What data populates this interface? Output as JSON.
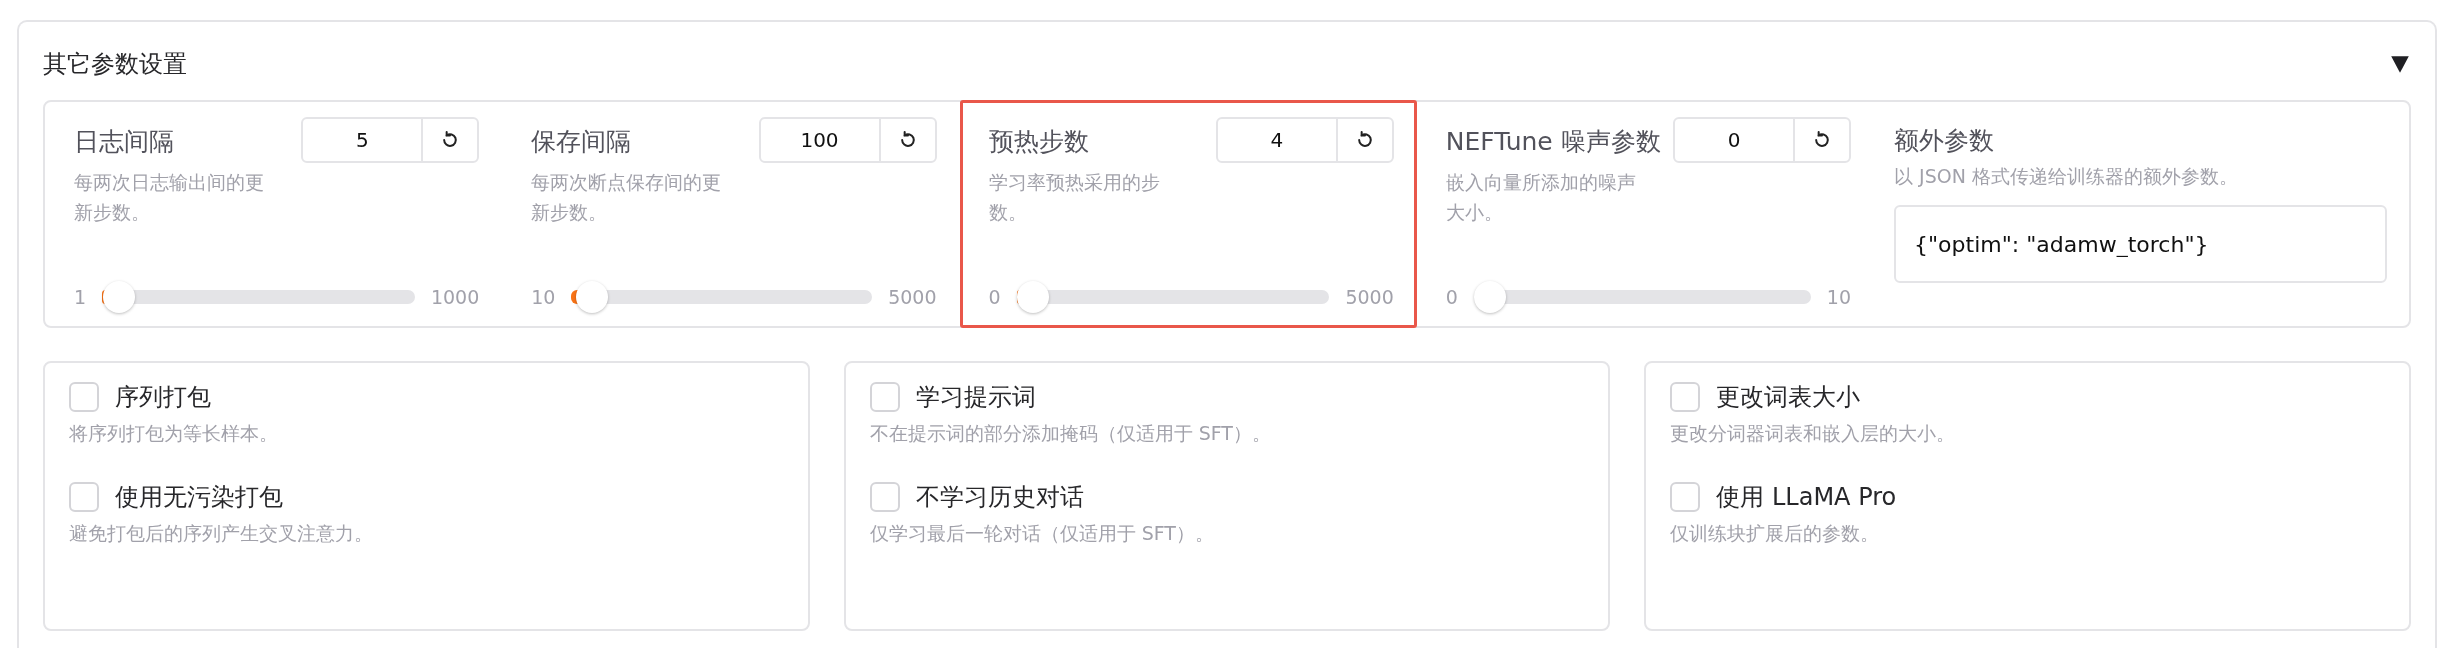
{
  "section": {
    "title": "其它参数设置",
    "expanded": true
  },
  "sliders": [
    {
      "label": "日志间隔",
      "description": "每两次日志输出间的更新步数。",
      "value": "5",
      "min": "1",
      "max": "1000",
      "level": 0.004,
      "highlighted": false
    },
    {
      "label": "保存间隔",
      "description": "每两次断点保存间的更新步数。",
      "value": "100",
      "min": "10",
      "max": "5000",
      "level": 0.018,
      "highlighted": false
    },
    {
      "label": "预热步数",
      "description": "学习率预热采用的步数。",
      "value": "4",
      "min": "0",
      "max": "5000",
      "level": 0.001,
      "highlighted": true
    },
    {
      "label": "NEFTune 噪声参数",
      "description": "嵌入向量所添加的噪声大小。",
      "value": "0",
      "min": "0",
      "max": "10",
      "level": 0,
      "highlighted": false
    }
  ],
  "extra": {
    "label": "额外参数",
    "description": "以 JSON 格式传递给训练器的额外参数。",
    "value": "{\"optim\": \"adamw_torch\"}"
  },
  "option_groups": [
    [
      {
        "label": "序列打包",
        "description": "将序列打包为等长样本。",
        "checked": false
      },
      {
        "label": "使用无污染打包",
        "description": "避免打包后的序列产生交叉注意力。",
        "checked": false
      }
    ],
    [
      {
        "label": "学习提示词",
        "description": "不在提示词的部分添加掩码（仅适用于 SFT）。",
        "checked": false
      },
      {
        "label": "不学习历史对话",
        "description": "仅学习最后一轮对话（仅适用于 SFT）。",
        "checked": false
      }
    ],
    [
      {
        "label": "更改词表大小",
        "description": "更改分词器词表和嵌入层的大小。",
        "checked": false
      },
      {
        "label": "使用 LLaMA Pro",
        "description": "仅训练块扩展后的参数。",
        "checked": false
      }
    ]
  ]
}
